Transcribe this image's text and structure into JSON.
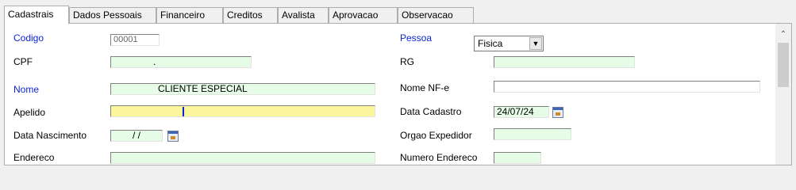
{
  "tabs": [
    "Cadastrais",
    "Dados Pessoais",
    "Financeiro",
    "Creditos",
    "Avalista",
    "Aprovacao",
    "Observacao"
  ],
  "form": {
    "codigo": {
      "label": "Codigo",
      "value": "00001"
    },
    "cpf": {
      "label": "CPF",
      "value": "."
    },
    "nome": {
      "label": "Nome",
      "value": "CLIENTE ESPECIAL"
    },
    "apelido": {
      "label": "Apelido",
      "value": ""
    },
    "data_nascimento": {
      "label": "Data Nascimento",
      "value": "/ /"
    },
    "endereco": {
      "label": "Endereco",
      "value": ""
    },
    "pessoa": {
      "label": "Pessoa",
      "value": "Fisica"
    },
    "rg": {
      "label": "RG",
      "value": ""
    },
    "nome_nfe": {
      "label": "Nome NF-e",
      "value": ""
    },
    "data_cadastro": {
      "label": "Data Cadastro",
      "value": "24/07/24"
    },
    "orgao_expedidor": {
      "label": "Orgao Expedidor",
      "value": ""
    },
    "numero_endereco": {
      "label": "Numero Endereco",
      "value": ""
    }
  },
  "icons": {
    "dropdown": "chevron-down-icon",
    "calendar": "calendar-icon",
    "scroll_up": "scroll-up-arrow-icon"
  },
  "colors": {
    "label_required": "#0a24d8",
    "field_green": "#e6fce6",
    "field_yellow": "#fbf59c"
  }
}
